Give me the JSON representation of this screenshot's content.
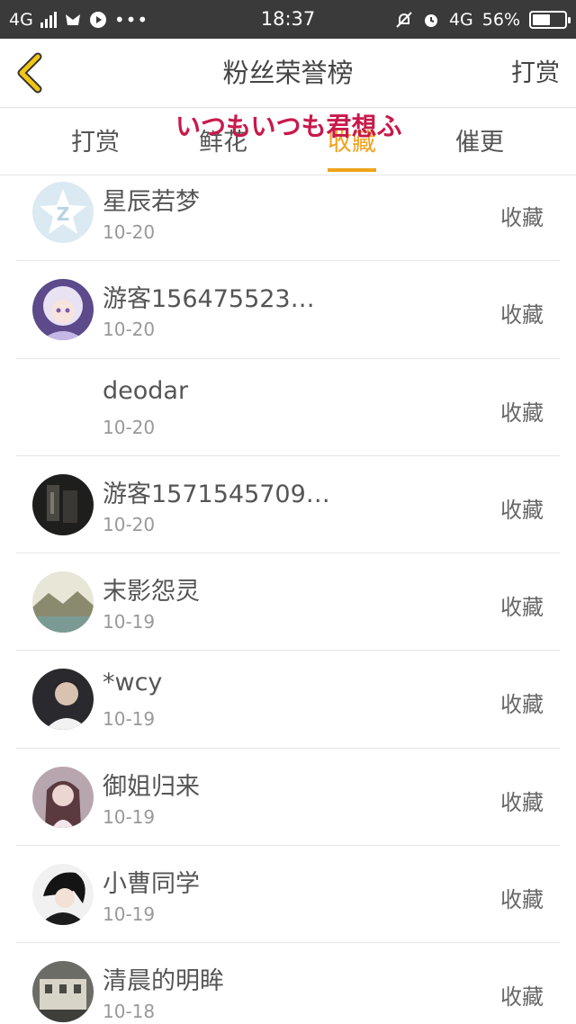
{
  "status_bar": {
    "network": "4G",
    "time": "18:37",
    "network_right": "4G",
    "battery_percent_text": "56%",
    "battery_level": 0.56
  },
  "header": {
    "title": "粉丝荣誉榜",
    "action": "打赏"
  },
  "overlay_text": "いつもいつも君想ふ",
  "tabs": [
    {
      "label": "打赏",
      "active": false
    },
    {
      "label": "鲜花",
      "active": false
    },
    {
      "label": "收藏",
      "active": true
    },
    {
      "label": "催更",
      "active": false
    }
  ],
  "fans": [
    {
      "name": "星辰若梦",
      "date": "10-20",
      "type": "收藏",
      "avatar": "default-qq-star-avatar"
    },
    {
      "name": "游客156475523…",
      "date": "10-20",
      "type": "收藏",
      "avatar": "anime-girl-avatar"
    },
    {
      "name": "deodar",
      "date": "10-20",
      "type": "收藏",
      "avatar": "none"
    },
    {
      "name": "游客1571545709…",
      "date": "10-20",
      "type": "收藏",
      "avatar": "dark-photo-avatar"
    },
    {
      "name": "末影怨灵",
      "date": "10-19",
      "type": "收藏",
      "avatar": "landscape-avatar"
    },
    {
      "name": "*wcy",
      "date": "10-19",
      "type": "收藏",
      "avatar": "boy-photo-avatar"
    },
    {
      "name": "御姐归来",
      "date": "10-19",
      "type": "收藏",
      "avatar": "girl-photo-avatar"
    },
    {
      "name": "小曹同学",
      "date": "10-19",
      "type": "收藏",
      "avatar": "boy-anime-avatar"
    },
    {
      "name": "清晨的明眸",
      "date": "10-18",
      "type": "收藏",
      "avatar": "building-photo-avatar"
    }
  ],
  "colors": {
    "accent": "#f0a21b",
    "status_bar_bg": "#3a3a3a",
    "watermark": "#c8194b"
  }
}
